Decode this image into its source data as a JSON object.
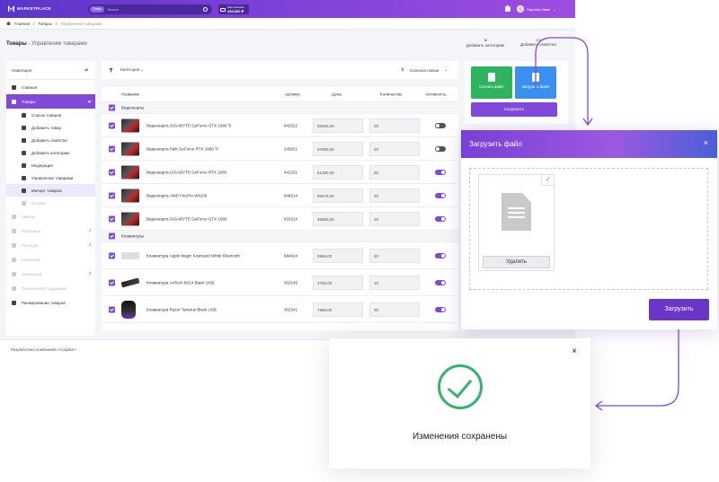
{
  "topbar": {
    "logo": "MARKETPLACE",
    "search_scope": "Товар",
    "search_placeholder": "Search",
    "wallet_label": "Мой кошелёк",
    "wallet_amount": "440,000 ₽",
    "user_name": "Партнёр Иван"
  },
  "breadcrumb": [
    "Главная",
    "Товары",
    "Управление товарами"
  ],
  "page": {
    "title": "Товары",
    "subtitle": " - Управление товарами"
  },
  "sidebar": {
    "header": "Навигация",
    "items": [
      {
        "label": "Главная"
      },
      {
        "label": "Товары"
      },
      {
        "label": "Список товаров"
      },
      {
        "label": "Добавить товар"
      },
      {
        "label": "Добавить свойство"
      },
      {
        "label": "Добавить категорию"
      },
      {
        "label": "Модерация"
      },
      {
        "label": "Управление товарами"
      },
      {
        "label": "Импорт товаров"
      },
      {
        "label": "Отзывы"
      },
      {
        "label": "Заказы"
      },
      {
        "label": "Логистика"
      },
      {
        "label": "Расходы"
      },
      {
        "label": "Комиссии"
      },
      {
        "label": "Аналитика"
      },
      {
        "label": "Техническая поддержка"
      },
      {
        "label": "Ранжирование товаров"
      }
    ]
  },
  "filter": {
    "category": "Категория",
    "sort": "Сначала новые"
  },
  "table": {
    "headers": [
      "Название",
      "Артикул",
      "Цена",
      "Количество",
      "Активность"
    ],
    "groups": [
      {
        "name": "Видеокарты",
        "rows": [
          {
            "name": "Видеокарта GIGABYTE GeForce GTX 1080 Ti",
            "sku": "642522",
            "price": "58450,00",
            "qty": "20",
            "active": false
          },
          {
            "name": "Видеокарта Palit GeForce RTX 2080 Ti",
            "sku": "245821",
            "price": "97850,00",
            "qty": "20",
            "active": false
          },
          {
            "name": "Видеокарта GIGABYTE GeForce RTX 2080",
            "sku": "642251",
            "price": "61360,00",
            "qty": "20",
            "active": true
          },
          {
            "name": "Видеокарта AMD FirePro W8100",
            "sku": "648214",
            "price": "86679,00",
            "qty": "20",
            "active": true
          },
          {
            "name": "Видеокарта GIGABYTE GeForce GTX 1080",
            "sku": "633214",
            "price": "39990,00",
            "qty": "20",
            "active": true
          }
        ]
      },
      {
        "name": "Клавиатуры",
        "rows": [
          {
            "name": "Клавиатура Apple Magic Keyboard White Bluetooth",
            "sku": "684414",
            "price": "5999,00",
            "qty": "20",
            "active": true
          },
          {
            "name": "Клавиатура A4Tech B314 Black USB",
            "sku": "302145",
            "price": "4780,00",
            "qty": "10",
            "active": true
          },
          {
            "name": "Клавиатура Razer Tartarus Black USB",
            "sku": "302541",
            "price": "7989,00",
            "qty": "30",
            "active": true
          }
        ]
      }
    ]
  },
  "actions": {
    "add_category": "Добавить категорию",
    "add_property": "Добавить свойство",
    "download": "Скачать файл",
    "upload": "Загрузить файл",
    "save": "Сохранить"
  },
  "footer": "Разработано компанией «Софбит»",
  "upload_modal": {
    "title": "Загрузить файл",
    "delete": "Удалить",
    "submit": "Загрузить"
  },
  "toast": {
    "message": "Изменения сохранены"
  },
  "colors": {
    "accent": "#8248d9",
    "success": "#35b46d",
    "download": "#2eb45f",
    "upload": "#3a8ff0"
  }
}
